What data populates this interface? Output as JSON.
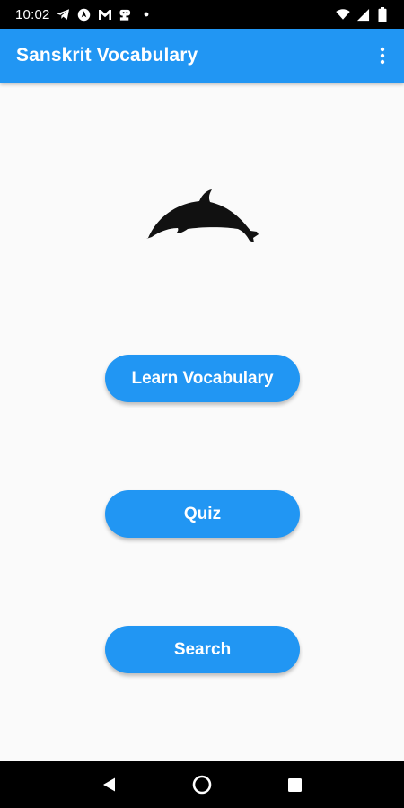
{
  "status_bar": {
    "time": "10:02",
    "notification_icons": [
      "telegram-icon",
      "nav-app-icon",
      "gmail-icon",
      "face-app-icon",
      "dot-icon"
    ],
    "system_icons": [
      "wifi-icon",
      "signal-icon",
      "battery-icon"
    ]
  },
  "app_bar": {
    "title": "Sanskrit Vocabulary",
    "menu_icon": "more-vert-icon",
    "background": "#2196f3"
  },
  "logo": {
    "icon": "dolphin-icon"
  },
  "buttons": {
    "learn_label": "Learn Vocabulary",
    "quiz_label": "Quiz",
    "search_label": "Search",
    "color": "#2196f3"
  },
  "nav_bar": {
    "back_icon": "back-triangle-icon",
    "home_icon": "home-circle-icon",
    "recents_icon": "recents-square-icon"
  }
}
